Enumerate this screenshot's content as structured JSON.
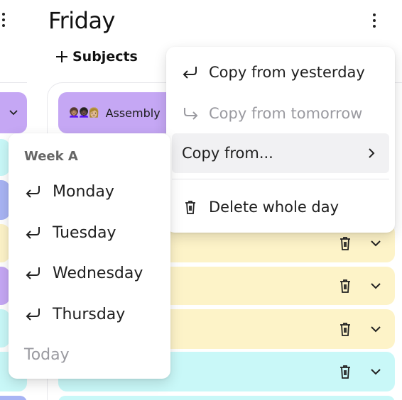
{
  "day": {
    "title": "Friday",
    "more_icon": "vertical-ellipsis-icon",
    "add_subjects_label": "Subjects",
    "add_icon": "plus-icon"
  },
  "lessons": [
    {
      "name": "Assembly",
      "emoji": "👩🏽‍🦱👩🏿‍🦱👩🏼",
      "color": "#c5a7f4"
    },
    {
      "color": "#fdf3c8"
    },
    {
      "color": "#fdf3c8"
    },
    {
      "color": "#fdf3c8"
    },
    {
      "color": "#c9f8f8"
    }
  ],
  "day_menu": {
    "items": [
      {
        "label": "Copy from yesterday",
        "icon": "return-arrow-icon",
        "disabled": false
      },
      {
        "label": "Copy from tomorrow",
        "icon": "forward-arrow-icon",
        "disabled": true
      },
      {
        "label": "Copy from...",
        "icon": "chevron-right-icon",
        "disabled": false,
        "highlighted": true
      },
      {
        "label": "Delete whole day",
        "icon": "trash-icon",
        "disabled": false
      }
    ]
  },
  "copy_from_submenu": {
    "group_label": "Week A",
    "items": [
      {
        "label": "Monday",
        "icon": "return-arrow-icon"
      },
      {
        "label": "Tuesday",
        "icon": "return-arrow-icon"
      },
      {
        "label": "Wednesday",
        "icon": "return-arrow-icon"
      },
      {
        "label": "Thursday",
        "icon": "return-arrow-icon"
      }
    ],
    "disabled_item": {
      "label": "Today"
    }
  },
  "colors": {
    "purple": "#c5a7f4",
    "yellow": "#fdf3c8",
    "cyan": "#c9f8f8",
    "blue": "#a8b4f4",
    "muted_text": "#9a9aa0"
  }
}
